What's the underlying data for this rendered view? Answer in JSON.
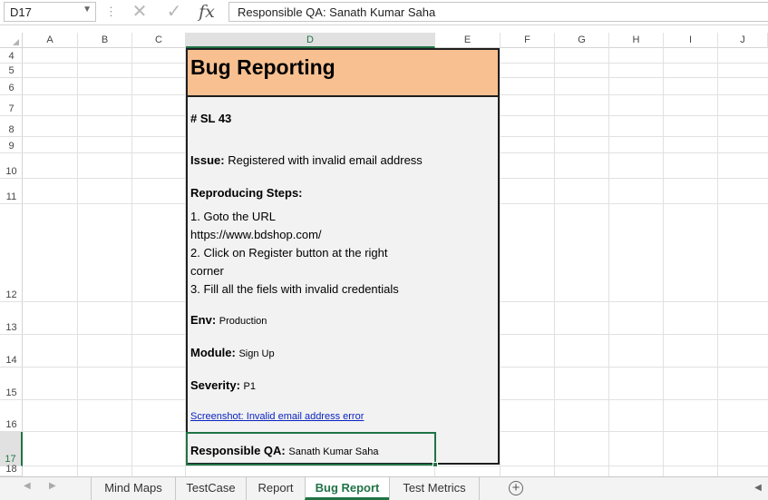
{
  "formula_bar": {
    "name_box": "D17",
    "formula": "Responsible QA: Sanath Kumar Saha"
  },
  "columns": [
    "A",
    "B",
    "C",
    "D",
    "E",
    "F",
    "G",
    "H",
    "I",
    "J"
  ],
  "active_column": "D",
  "rows": [
    "4",
    "5",
    "6",
    "7",
    "8",
    "9",
    "10",
    "11",
    "12",
    "13",
    "14",
    "15",
    "16",
    "17",
    "18"
  ],
  "active_row": "17",
  "card": {
    "title": "Bug Reporting",
    "id": "# SL 43",
    "issue_label": "Issue:",
    "issue_value": "Registered with invalid email address",
    "steps_label": "Reproducing Steps:",
    "steps": [
      "1. Goto the URL",
      "https://www.bdshop.com/",
      "2. Click on Register button at the right",
      "corner",
      "3. Fill all the fiels with invalid credentials"
    ],
    "env_label": "Env:",
    "env_value": "Production",
    "module_label": "Module:",
    "module_value": "Sign Up",
    "severity_label": "Severity:",
    "severity_value": "P1",
    "screenshot_link": "Screenshot: Invalid email address error",
    "qa_label": "Responsible QA:",
    "qa_value": "Sanath Kumar Saha"
  },
  "sheet_tabs": [
    "Mind Maps",
    "TestCase",
    "Report",
    "Bug Report",
    "Test Metrics"
  ],
  "active_sheet": "Bug Report",
  "colors": {
    "accent": "#217346",
    "title_band": "#f8c090",
    "card_bg": "#f2f2f2",
    "link": "#0b23c1"
  }
}
